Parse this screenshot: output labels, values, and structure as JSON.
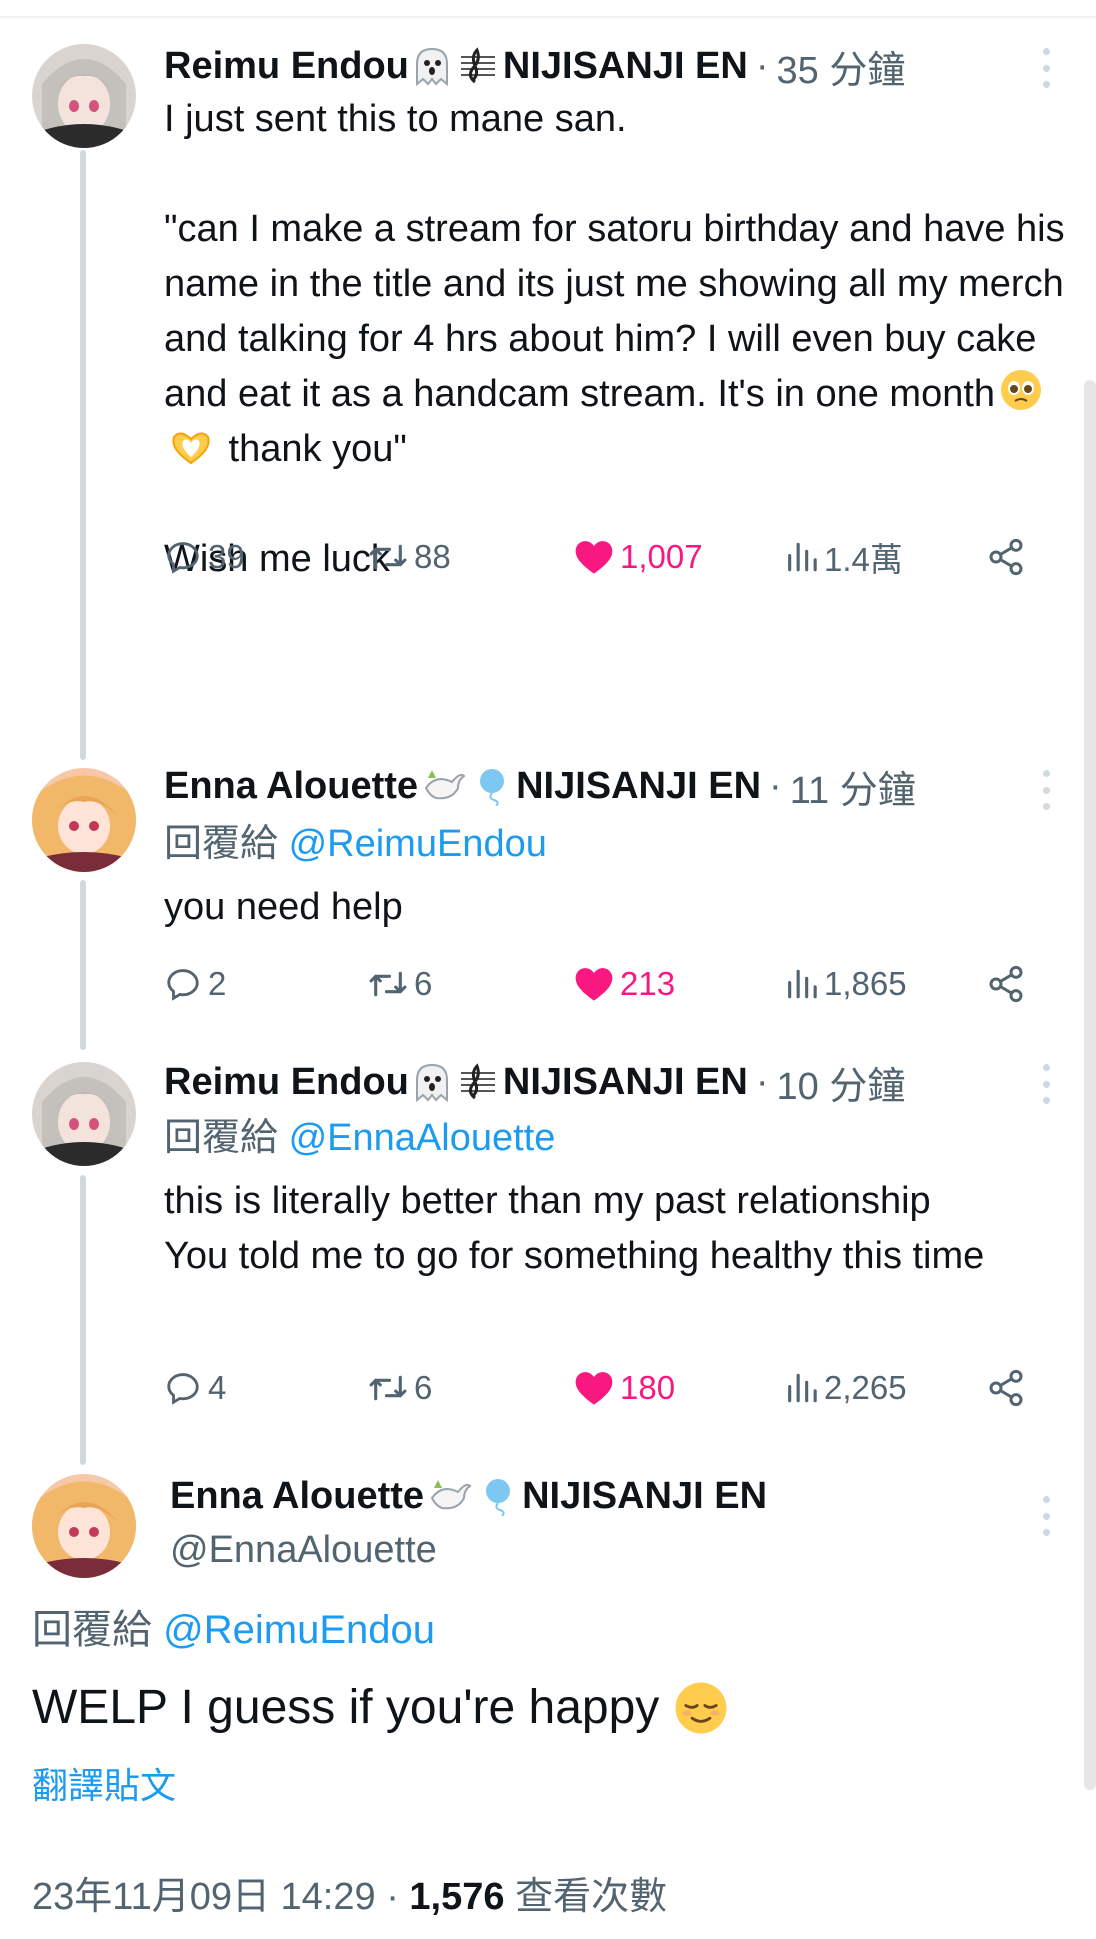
{
  "tweets": [
    {
      "name": "Reimu Endou",
      "affiliation": "NIJISANJI EN",
      "time": "35 分鐘",
      "text": "I just sent this to mane san.\n\n\"can I make a stream for satoru birthday and have his name in the title and its just me showing all my merch and talking for 4 hrs about him? I will even buy cake and eat it as a handcam stream. It's in one month",
      "text_tail": " thank you\"\n\nWish me luck",
      "stats": {
        "replies": "39",
        "retweets": "88",
        "likes": "1,007",
        "views": "1.4萬"
      }
    },
    {
      "name": "Enna Alouette",
      "affiliation": "NIJISANJI EN",
      "time": "11 分鐘",
      "reply_prefix": "回覆給",
      "reply_to": "@ReimuEndou",
      "text": "you need help",
      "stats": {
        "replies": "2",
        "retweets": "6",
        "likes": "213",
        "views": "1,865"
      }
    },
    {
      "name": "Reimu Endou",
      "affiliation": "NIJISANJI EN",
      "time": "10 分鐘",
      "reply_prefix": "回覆給",
      "reply_to": "@EnnaAlouette",
      "text": "this is literally better than my past relationship\nYou told me to go for something healthy this time",
      "stats": {
        "replies": "4",
        "retweets": "6",
        "likes": "180",
        "views": "2,265"
      }
    }
  ],
  "main": {
    "name": "Enna Alouette",
    "affiliation": "NIJISANJI EN",
    "handle": "@EnnaAlouette",
    "reply_prefix": "回覆給",
    "reply_to": "@ReimuEndou",
    "text": "WELP I guess if you're happy",
    "translate": "翻譯貼文",
    "date": "23年11月09日 14:29",
    "views": "1,576",
    "views_label": "查看次數"
  },
  "separator": "·",
  "colors": {
    "accent": "#1d9bf0",
    "like": "#f91880",
    "muted": "#536471",
    "text": "#0f1419"
  },
  "icons": [
    "reply-icon",
    "retweet-icon",
    "like-icon",
    "views-icon",
    "share-icon",
    "more-icon",
    "ghost-emoji",
    "music-note-emoji",
    "dove-emoji",
    "balloon-emoji",
    "pleading-face-emoji",
    "heart-hands-emoji",
    "relieved-face-emoji"
  ]
}
